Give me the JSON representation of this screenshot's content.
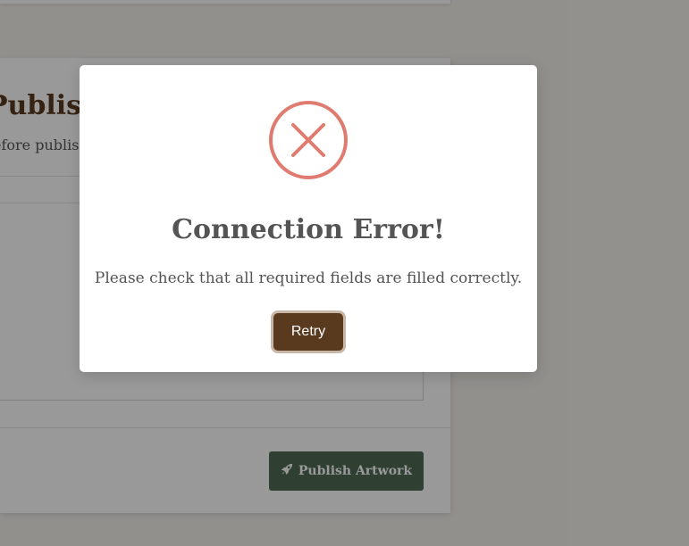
{
  "page": {
    "title": "Publish",
    "subtitle": "efore publis"
  },
  "footer": {
    "publish_label": "Publish Artwork",
    "publish_icon": "rocket-icon"
  },
  "modal": {
    "icon": "error-x-icon",
    "icon_color": "#e07b6f",
    "title": "Connection Error!",
    "message": "Please check that all required fields are filled correctly.",
    "retry_label": "Retry"
  },
  "colors": {
    "brand_brown": "#5a3a1e",
    "publish_green": "#4f6b55"
  }
}
